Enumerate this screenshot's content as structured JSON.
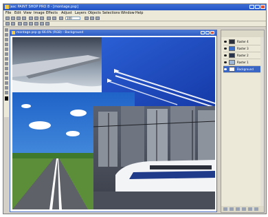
{
  "app": {
    "title": "Jasc PAINT SHOP PRO 8 - [montage.psp]",
    "menu": [
      "File",
      "Edit",
      "View",
      "Image",
      "Effects",
      "Adjust",
      "Layers",
      "Objects",
      "Selections",
      "Window",
      "Help"
    ],
    "zoom_value": "100"
  },
  "document": {
    "title": "montage.psp @ 66.6% (RGB) - Background"
  },
  "layers_panel": {
    "layers": [
      {
        "name": "Raster 4",
        "selected": false,
        "thumb_color": "#2b2f3a"
      },
      {
        "name": "Raster 3",
        "selected": false,
        "thumb_color": "#3c6fc9"
      },
      {
        "name": "Raster 2",
        "selected": false,
        "thumb_color": "#28324a"
      },
      {
        "name": "Raster 1",
        "selected": false,
        "thumb_color": "#9fb8d8"
      },
      {
        "name": "Background",
        "selected": true,
        "thumb_color": "#ffffff"
      }
    ]
  },
  "colors": {
    "titlebar": "#2353c4",
    "selection": "#3a66c6",
    "sky_blue": "#2b6fd0",
    "airplane_sky": "#1f4fc2"
  }
}
